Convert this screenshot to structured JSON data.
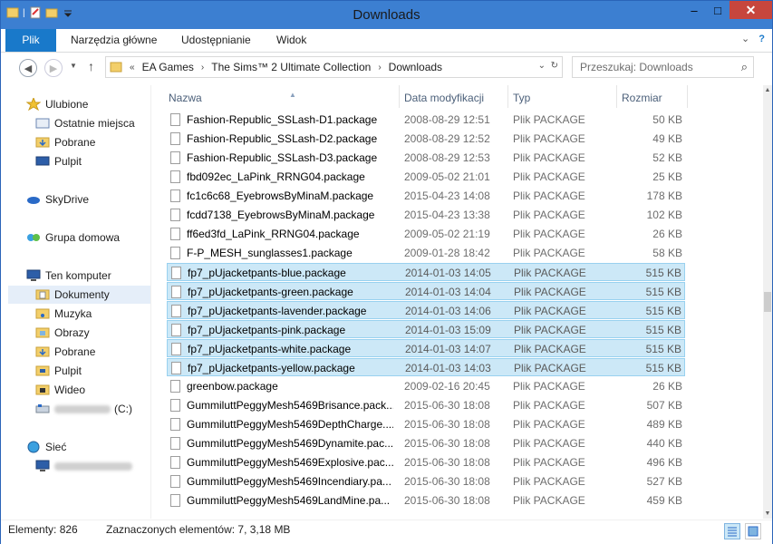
{
  "window": {
    "title": "Downloads"
  },
  "titlebar": {
    "minimize": "–",
    "maximize": "□",
    "close": "✕"
  },
  "ribbon": {
    "tabs": [
      "Plik",
      "Narzędzia główne",
      "Udostępnianie",
      "Widok"
    ],
    "expand": "⌄",
    "help": "?"
  },
  "address": {
    "prefix": "«",
    "crumbs": [
      "EA Games",
      "The Sims™ 2 Ultimate Collection",
      "Downloads"
    ],
    "dropdown": "⌄",
    "refresh": "↻",
    "search_placeholder": "Przeszukaj: Downloads"
  },
  "nav": {
    "favorites": "Ulubione",
    "recent": "Ostatnie miejsca",
    "downloads": "Pobrane",
    "desktop": "Pulpit",
    "skydrive": "SkyDrive",
    "homegroup": "Grupa domowa",
    "computer": "Ten komputer",
    "documents": "Dokumenty",
    "music": "Muzyka",
    "pictures": "Obrazy",
    "downloads2": "Pobrane",
    "desktop2": "Pulpit",
    "videos": "Wideo",
    "drive_suffix": "(C:)",
    "network": "Sieć"
  },
  "columns": {
    "name": "Nazwa",
    "date": "Data modyfikacji",
    "type": "Typ",
    "size": "Rozmiar"
  },
  "files": [
    {
      "name": "Fashion-Republic_SSLash-D1.package",
      "date": "2008-08-29 12:51",
      "type": "Plik PACKAGE",
      "size": "50 KB",
      "selected": false
    },
    {
      "name": "Fashion-Republic_SSLash-D2.package",
      "date": "2008-08-29 12:52",
      "type": "Plik PACKAGE",
      "size": "49 KB",
      "selected": false
    },
    {
      "name": "Fashion-Republic_SSLash-D3.package",
      "date": "2008-08-29 12:53",
      "type": "Plik PACKAGE",
      "size": "52 KB",
      "selected": false
    },
    {
      "name": "fbd092ec_LaPink_RRNG04.package",
      "date": "2009-05-02 21:01",
      "type": "Plik PACKAGE",
      "size": "25 KB",
      "selected": false
    },
    {
      "name": "fc1c6c68_EyebrowsByMinaM.package",
      "date": "2015-04-23 14:08",
      "type": "Plik PACKAGE",
      "size": "178 KB",
      "selected": false
    },
    {
      "name": "fcdd7138_EyebrowsByMinaM.package",
      "date": "2015-04-23 13:38",
      "type": "Plik PACKAGE",
      "size": "102 KB",
      "selected": false
    },
    {
      "name": "ff6ed3fd_LaPink_RRNG04.package",
      "date": "2009-05-02 21:19",
      "type": "Plik PACKAGE",
      "size": "26 KB",
      "selected": false
    },
    {
      "name": "F-P_MESH_sunglasses1.package",
      "date": "2009-01-28 18:42",
      "type": "Plik PACKAGE",
      "size": "58 KB",
      "selected": false
    },
    {
      "name": "fp7_pUjacketpants-blue.package",
      "date": "2014-01-03 14:05",
      "type": "Plik PACKAGE",
      "size": "515 KB",
      "selected": true
    },
    {
      "name": "fp7_pUjacketpants-green.package",
      "date": "2014-01-03 14:04",
      "type": "Plik PACKAGE",
      "size": "515 KB",
      "selected": true
    },
    {
      "name": "fp7_pUjacketpants-lavender.package",
      "date": "2014-01-03 14:06",
      "type": "Plik PACKAGE",
      "size": "515 KB",
      "selected": true
    },
    {
      "name": "fp7_pUjacketpants-pink.package",
      "date": "2014-01-03 15:09",
      "type": "Plik PACKAGE",
      "size": "515 KB",
      "selected": true
    },
    {
      "name": "fp7_pUjacketpants-white.package",
      "date": "2014-01-03 14:07",
      "type": "Plik PACKAGE",
      "size": "515 KB",
      "selected": true
    },
    {
      "name": "fp7_pUjacketpants-yellow.package",
      "date": "2014-01-03 14:03",
      "type": "Plik PACKAGE",
      "size": "515 KB",
      "selected": true
    },
    {
      "name": "greenbow.package",
      "date": "2009-02-16 20:45",
      "type": "Plik PACKAGE",
      "size": "26 KB",
      "selected": false
    },
    {
      "name": "GummiluttPeggyMesh5469Brisance.pack...",
      "date": "2015-06-30 18:08",
      "type": "Plik PACKAGE",
      "size": "507 KB",
      "selected": false
    },
    {
      "name": "GummiluttPeggyMesh5469DepthCharge....",
      "date": "2015-06-30 18:08",
      "type": "Plik PACKAGE",
      "size": "489 KB",
      "selected": false
    },
    {
      "name": "GummiluttPeggyMesh5469Dynamite.pac...",
      "date": "2015-06-30 18:08",
      "type": "Plik PACKAGE",
      "size": "440 KB",
      "selected": false
    },
    {
      "name": "GummiluttPeggyMesh5469Explosive.pac...",
      "date": "2015-06-30 18:08",
      "type": "Plik PACKAGE",
      "size": "496 KB",
      "selected": false
    },
    {
      "name": "GummiluttPeggyMesh5469Incendiary.pa...",
      "date": "2015-06-30 18:08",
      "type": "Plik PACKAGE",
      "size": "527 KB",
      "selected": false
    },
    {
      "name": "GummiluttPeggyMesh5469LandMine.pa...",
      "date": "2015-06-30 18:08",
      "type": "Plik PACKAGE",
      "size": "459 KB",
      "selected": false
    }
  ],
  "status": {
    "count": "Elementy: 826",
    "selected": "Zaznaczonych elementów: 7, 3,18 MB"
  }
}
